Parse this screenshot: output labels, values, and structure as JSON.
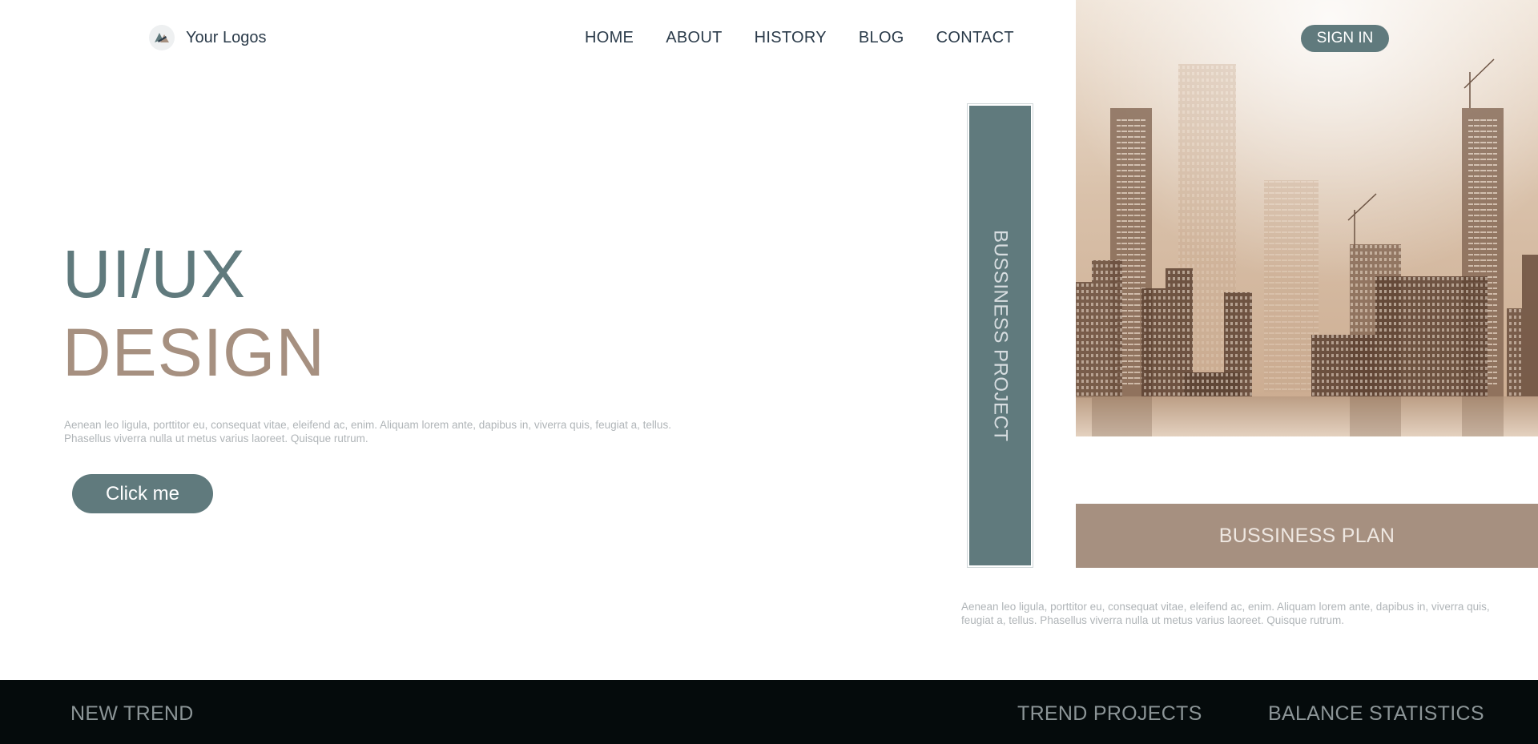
{
  "header": {
    "logo_text": "Your Logos",
    "nav": [
      "HOME",
      "ABOUT",
      "HISTORY",
      "BLOG",
      "CONTACT"
    ],
    "signin_label": "SIGN IN"
  },
  "hero": {
    "title_line1": "UI/UX",
    "title_line2": "DESIGN",
    "description": "Aenean leo ligula, porttitor eu, consequat vitae, eleifend ac, enim. Aliquam lorem ante, dapibus in, viverra quis, feugiat a, tellus. Phasellus viverra nulla ut metus varius laoreet. Quisque rutrum.",
    "cta_label": "Click me"
  },
  "project": {
    "vertical_label": "BUSSINESS PROJECT",
    "plan_label": "BUSSINESS PLAN",
    "description": "Aenean leo ligula, porttitor eu, consequat vitae, eleifend ac, enim. Aliquam lorem ante, dapibus in, viverra quis, feugiat a, tellus. Phasellus viverra nulla ut metus varius laoreet. Quisque rutrum."
  },
  "footer": {
    "items": [
      "NEW TREND",
      "TREND PROJECTS",
      "BALANCE STATISTICS"
    ]
  },
  "colors": {
    "accent_teal": "#607a7d",
    "accent_tan": "#a69080",
    "footer_bg": "#050b0c"
  },
  "icons": {
    "logo": "logo-icon",
    "image": "city-skyline-image"
  }
}
